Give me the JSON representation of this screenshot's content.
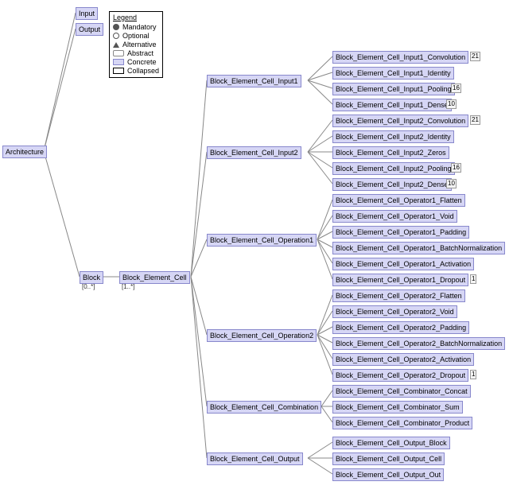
{
  "legend": {
    "title": "Legend",
    "mandatory": "Mandatory",
    "optional": "Optional",
    "alternative": "Alternative",
    "abstract": "Abstract",
    "concrete": "Concrete",
    "collapsed": "Collapsed"
  },
  "root": {
    "label": "Architecture"
  },
  "top": {
    "input": "Input",
    "output": "Output"
  },
  "block": {
    "label": "Block",
    "card": "[0..*]"
  },
  "cell": {
    "label": "Block_Element_Cell",
    "card": "[1..*]"
  },
  "mid": {
    "in1": "Block_Element_Cell_Input1",
    "in2": "Block_Element_Cell_Input2",
    "op1": "Block_Element_Cell_Operation1",
    "op2": "Block_Element_Cell_Operation2",
    "comb": "Block_Element_Cell_Combination",
    "out": "Block_Element_Cell_Output"
  },
  "leaves": {
    "in1": {
      "conv": {
        "label": "Block_Element_Cell_Input1_Convolution",
        "n": "21"
      },
      "iden": {
        "label": "Block_Element_Cell_Input1_Identity"
      },
      "pool": {
        "label": "Block_Element_Cell_Input1_Pooling",
        "n": "16"
      },
      "dense": {
        "label": "Block_Element_Cell_Input1_Dense",
        "n": "10"
      }
    },
    "in2": {
      "conv": {
        "label": "Block_Element_Cell_Input2_Convolution",
        "n": "21"
      },
      "iden": {
        "label": "Block_Element_Cell_Input2_Identity"
      },
      "zeros": {
        "label": "Block_Element_Cell_Input2_Zeros"
      },
      "pool": {
        "label": "Block_Element_Cell_Input2_Pooling",
        "n": "16"
      },
      "dense": {
        "label": "Block_Element_Cell_Input2_Dense",
        "n": "10"
      }
    },
    "op1": {
      "flat": {
        "label": "Block_Element_Cell_Operator1_Flatten"
      },
      "void": {
        "label": "Block_Element_Cell_Operator1_Void"
      },
      "pad": {
        "label": "Block_Element_Cell_Operator1_Padding"
      },
      "bn": {
        "label": "Block_Element_Cell_Operator1_BatchNormalization"
      },
      "act": {
        "label": "Block_Element_Cell_Operator1_Activation"
      },
      "drop": {
        "label": "Block_Element_Cell_Operator1_Dropout",
        "n": "1"
      }
    },
    "op2": {
      "flat": {
        "label": "Block_Element_Cell_Operator2_Flatten"
      },
      "void": {
        "label": "Block_Element_Cell_Operator2_Void"
      },
      "pad": {
        "label": "Block_Element_Cell_Operator2_Padding"
      },
      "bn": {
        "label": "Block_Element_Cell_Operator2_BatchNormalization"
      },
      "act": {
        "label": "Block_Element_Cell_Operator2_Activation"
      },
      "drop": {
        "label": "Block_Element_Cell_Operator2_Dropout",
        "n": "1"
      }
    },
    "comb": {
      "concat": {
        "label": "Block_Element_Cell_Combinator_Concat"
      },
      "sum": {
        "label": "Block_Element_Cell_Combinator_Sum"
      },
      "prod": {
        "label": "Block_Element_Cell_Combinator_Product"
      }
    },
    "out": {
      "block": {
        "label": "Block_Element_Cell_Output_Block"
      },
      "cell": {
        "label": "Block_Element_Cell_Output_Cell"
      },
      "oout": {
        "label": "Block_Element_Cell_Output_Out"
      }
    }
  }
}
